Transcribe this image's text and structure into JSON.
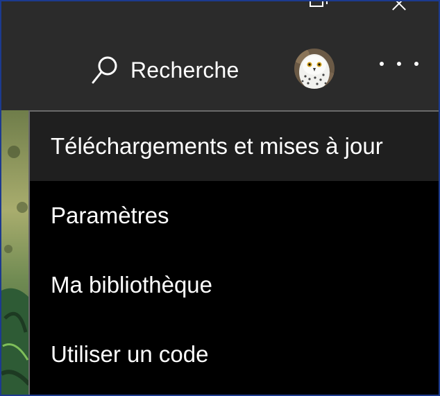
{
  "header": {
    "search_label": "Recherche",
    "icons": {
      "search": "search-icon",
      "avatar": "snowy-owl-avatar",
      "more": "more-options-icon",
      "restore": "restore-window-icon",
      "close": "close-window-icon"
    }
  },
  "menu": {
    "items": [
      {
        "label": "Téléchargements et mises à jour",
        "state": "hover"
      },
      {
        "label": "Paramètres"
      },
      {
        "label": "Ma bibliothèque"
      },
      {
        "label": "Utiliser un code"
      }
    ]
  },
  "colors": {
    "topbar": "#2b2b2b",
    "menu_bg": "#000000",
    "menu_hover": "#1f1f1f",
    "text": "#ffffff",
    "frame_border": "#1c3a8f"
  }
}
